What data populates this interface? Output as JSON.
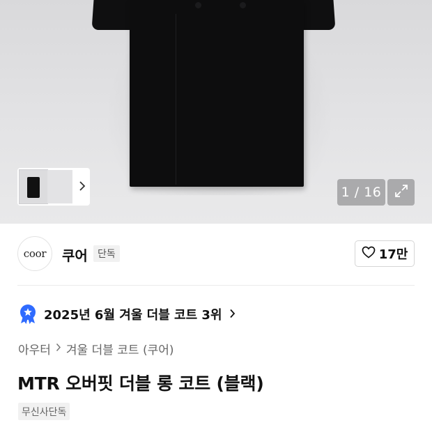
{
  "gallery": {
    "counter": "1 / 16",
    "current_image": 1,
    "total_images": 16
  },
  "brand": {
    "logo_text": "coor",
    "name": "쿠어",
    "badge": "단독"
  },
  "likes": {
    "count": "17만"
  },
  "ranking": {
    "text": "2025년 6월 겨울 더블 코트 3위"
  },
  "breadcrumb": {
    "items": [
      "아우터",
      "겨울 더블 코트 (쿠어)"
    ]
  },
  "product": {
    "title": "MTR 오버핏 더블 롱 코트 (블랙)",
    "tag": "무신사단독"
  },
  "colors": {
    "rank_badge": "#2f6bff",
    "text_primary": "#111111",
    "text_secondary": "#666666"
  },
  "icons": [
    "chevron-right-icon",
    "expand-icon",
    "heart-icon",
    "ranking-badge-icon"
  ]
}
